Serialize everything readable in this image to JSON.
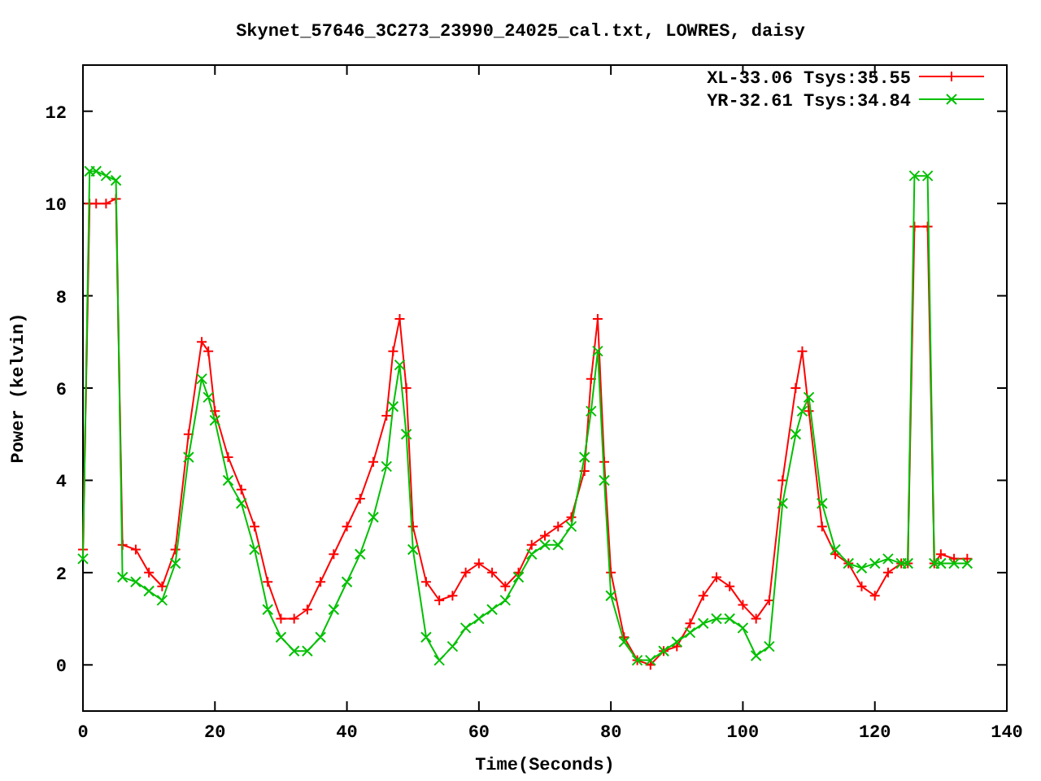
{
  "chart_data": {
    "type": "line",
    "title": "Skynet_57646_3C273_23990_24025_cal.txt, LOWRES, daisy",
    "xlabel": "Time(Seconds)",
    "ylabel": "Power (kelvin)",
    "x": [
      0,
      1,
      2,
      3.5,
      5,
      6,
      8,
      10,
      12,
      14,
      16,
      18,
      19,
      20,
      22,
      24,
      26,
      28,
      30,
      32,
      34,
      36,
      38,
      40,
      42,
      44,
      46,
      47,
      48,
      49,
      50,
      52,
      54,
      56,
      58,
      60,
      62,
      64,
      66,
      68,
      70,
      72,
      74,
      76,
      77,
      78,
      79,
      80,
      82,
      84,
      86,
      88,
      90,
      92,
      94,
      96,
      98,
      100,
      102,
      104,
      106,
      108,
      109,
      110,
      112,
      114,
      116,
      118,
      120,
      122,
      124,
      125,
      126,
      128,
      129,
      130,
      132,
      134
    ],
    "series": [
      {
        "name": "XL-33.06 Tsys:35.55",
        "color": "#ff0000",
        "marker": "plus",
        "values": [
          2.5,
          10,
          10,
          10,
          10.1,
          2.6,
          2.5,
          2.0,
          1.7,
          2.5,
          5,
          7,
          6.8,
          5.5,
          4.5,
          3.8,
          3,
          1.8,
          1.0,
          1.0,
          1.2,
          1.8,
          2.4,
          3,
          3.6,
          4.4,
          5.4,
          6.8,
          7.5,
          6,
          3,
          1.8,
          1.4,
          1.5,
          2.0,
          2.2,
          2.0,
          1.7,
          2.0,
          2.6,
          2.8,
          3.0,
          3.2,
          4.2,
          6.2,
          7.5,
          4.4,
          2.0,
          0.6,
          0.1,
          0.0,
          0.3,
          0.4,
          0.9,
          1.5,
          1.9,
          1.7,
          1.3,
          1.0,
          1.4,
          4,
          6,
          6.8,
          5.5,
          3,
          2.4,
          2.2,
          1.7,
          1.5,
          2.0,
          2.2,
          2.2,
          9.5,
          9.5,
          2.2,
          2.4,
          2.3,
          2.3
        ]
      },
      {
        "name": "YR-32.61 Tsys:34.84",
        "color": "#00c000",
        "marker": "cross",
        "values": [
          2.3,
          10.7,
          10.7,
          10.6,
          10.5,
          1.9,
          1.8,
          1.6,
          1.4,
          2.2,
          4.5,
          6.2,
          5.8,
          5.3,
          4,
          3.5,
          2.5,
          1.2,
          0.6,
          0.3,
          0.3,
          0.6,
          1.2,
          1.8,
          2.4,
          3.2,
          4.3,
          5.6,
          6.5,
          5,
          2.5,
          0.6,
          0.1,
          0.4,
          0.8,
          1.0,
          1.2,
          1.4,
          1.9,
          2.4,
          2.6,
          2.6,
          3.0,
          4.5,
          5.5,
          6.8,
          4,
          1.5,
          0.5,
          0.1,
          0.1,
          0.3,
          0.5,
          0.7,
          0.9,
          1.0,
          1.0,
          0.8,
          0.2,
          0.4,
          3.5,
          5,
          5.5,
          5.8,
          3.5,
          2.5,
          2.2,
          2.1,
          2.2,
          2.3,
          2.2,
          2.2,
          10.6,
          10.6,
          2.2,
          2.2,
          2.2,
          2.2
        ]
      }
    ],
    "legend": true,
    "xlim": [
      0,
      140
    ],
    "ylim": [
      -1,
      13
    ],
    "xticks": [
      0,
      20,
      40,
      60,
      80,
      100,
      120,
      140
    ],
    "yticks": [
      0,
      2,
      4,
      6,
      8,
      10,
      12
    ]
  }
}
